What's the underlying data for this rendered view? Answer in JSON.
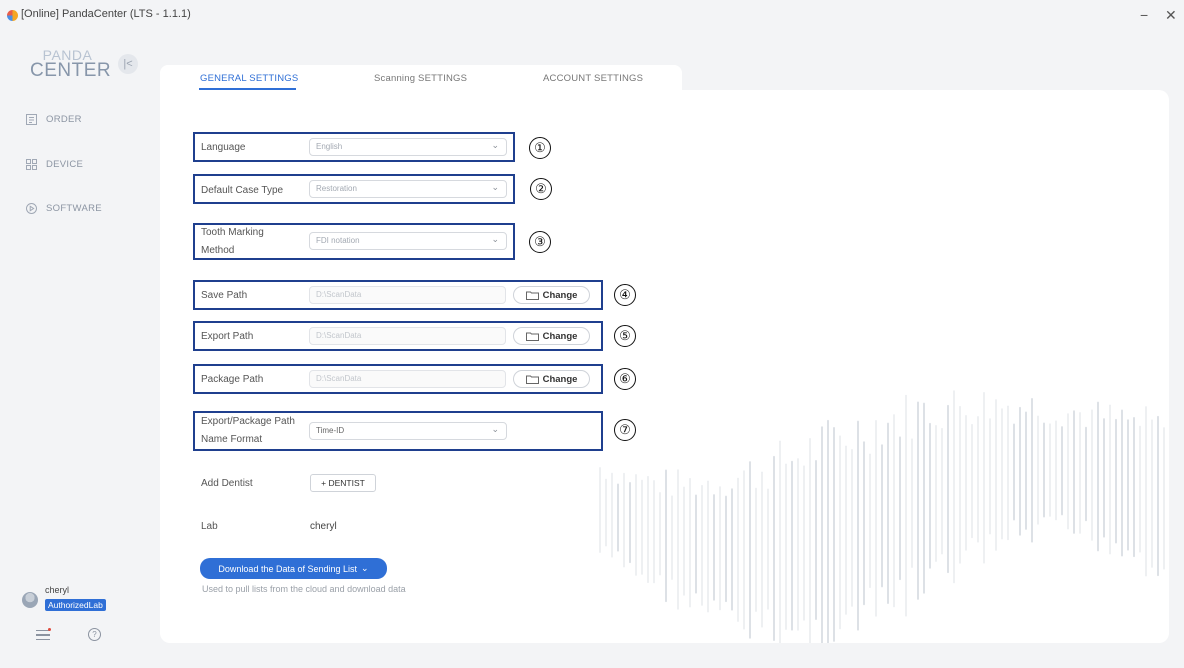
{
  "window": {
    "title": "[Online] PandaCenter (LTS - 1.1.1)",
    "minimize_icon": "minimize-icon",
    "close_icon": "close-icon"
  },
  "logo": {
    "top": "PANDA",
    "bottom": "CENTER"
  },
  "sidebar": {
    "collapse_label": "|<",
    "items": [
      {
        "label": "ORDER",
        "icon": "order-icon"
      },
      {
        "label": "DEVICE",
        "icon": "device-icon"
      },
      {
        "label": "SOFTWARE",
        "icon": "software-icon"
      }
    ]
  },
  "user": {
    "name": "cheryl",
    "role": "AuthorizedLab"
  },
  "tabs": [
    {
      "label": "GENERAL SETTINGS",
      "active": true
    },
    {
      "label": "Scanning SETTINGS",
      "active": false
    },
    {
      "label": "ACCOUNT SETTINGS",
      "active": false
    }
  ],
  "settings": {
    "language": {
      "label": "Language",
      "value": "English",
      "marker": "①"
    },
    "case_type": {
      "label": "Default Case Type",
      "value": "Restoration",
      "marker": "②"
    },
    "tooth_marking": {
      "label_line1": "Tooth Marking",
      "label_line2": "Method",
      "value": "FDI notation",
      "marker": "③"
    },
    "save_path": {
      "label": "Save Path",
      "value": "D:\\ScanData",
      "button": "Change",
      "marker": "④"
    },
    "export_path": {
      "label": "Export Path",
      "value": "D:\\ScanData",
      "button": "Change",
      "marker": "⑤"
    },
    "package_path": {
      "label": "Package Path",
      "value": "D:\\ScanData",
      "button": "Change",
      "marker": "⑥"
    },
    "name_format": {
      "label_line1": "Export/Package Path",
      "label_line2": "Name Format",
      "value": "Time-ID",
      "marker": "⑦"
    },
    "add_dentist": {
      "label": "Add Dentist",
      "button": "+ DENTIST"
    },
    "lab": {
      "label": "Lab",
      "value": "cheryl"
    }
  },
  "download": {
    "button": "Download the Data of Sending List",
    "hint": "Used to pull lists from the cloud and download data"
  },
  "colors": {
    "accent": "#2f6fd6",
    "highlight_border": "#1f3f8e",
    "background": "#f3f4f6"
  }
}
